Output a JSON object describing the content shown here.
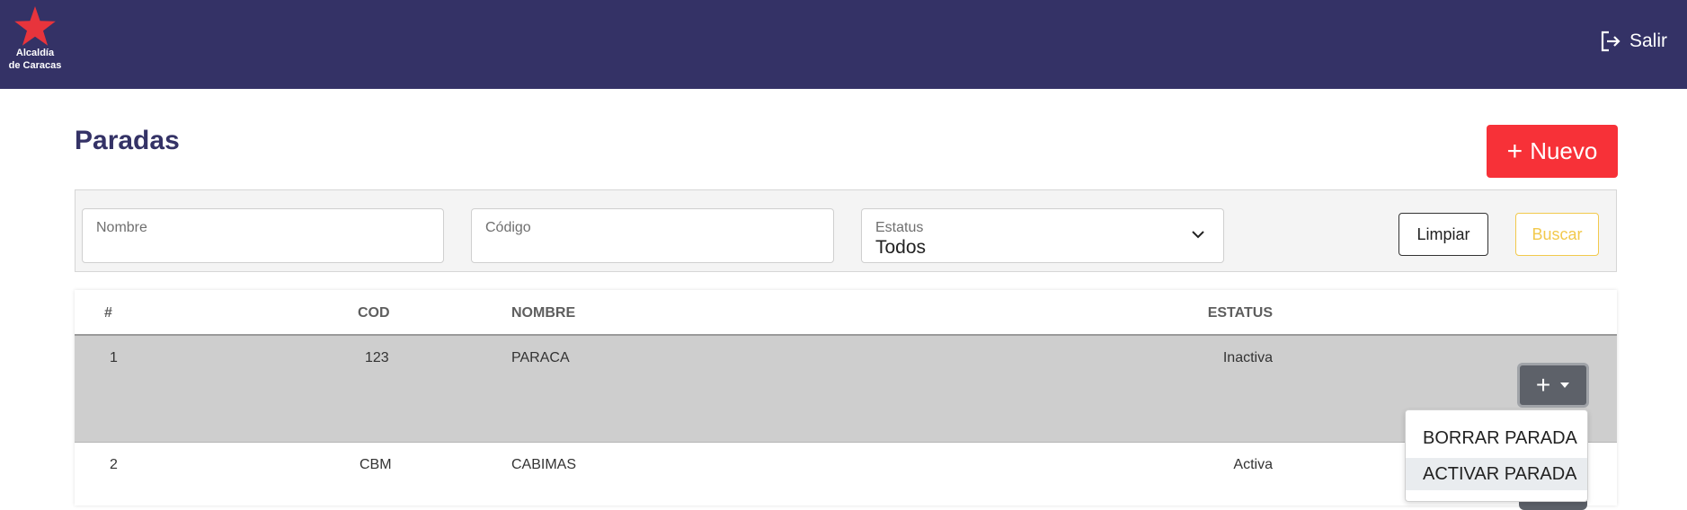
{
  "header": {
    "logo_lines": [
      "Alcaldía",
      "de Caracas"
    ],
    "logout_label": "Salir"
  },
  "page": {
    "title": "Paradas",
    "new_button_label": "Nuevo"
  },
  "filters": {
    "name_placeholder": "Nombre",
    "code_placeholder": "Código",
    "status_label": "Estatus",
    "status_value": "Todos",
    "clear_label": "Limpiar",
    "search_label": "Buscar"
  },
  "table": {
    "columns": [
      "#",
      "COD",
      "NOMBRE",
      "ESTATUS"
    ],
    "rows": [
      {
        "num": "1",
        "code": "123",
        "name": "PARACA",
        "status": "Inactiva"
      },
      {
        "num": "2",
        "code": "CBM",
        "name": "CABIMAS",
        "status": "Activa"
      }
    ]
  },
  "action_menu": {
    "items": [
      "BORRAR PARADA",
      "ACTIVAR PARADA"
    ]
  },
  "colors": {
    "topbar": "#343266",
    "accent_red": "#f73138",
    "search_yellow": "#f2c94c",
    "selected_row": "#cecece",
    "action_button": "#5d6169"
  }
}
